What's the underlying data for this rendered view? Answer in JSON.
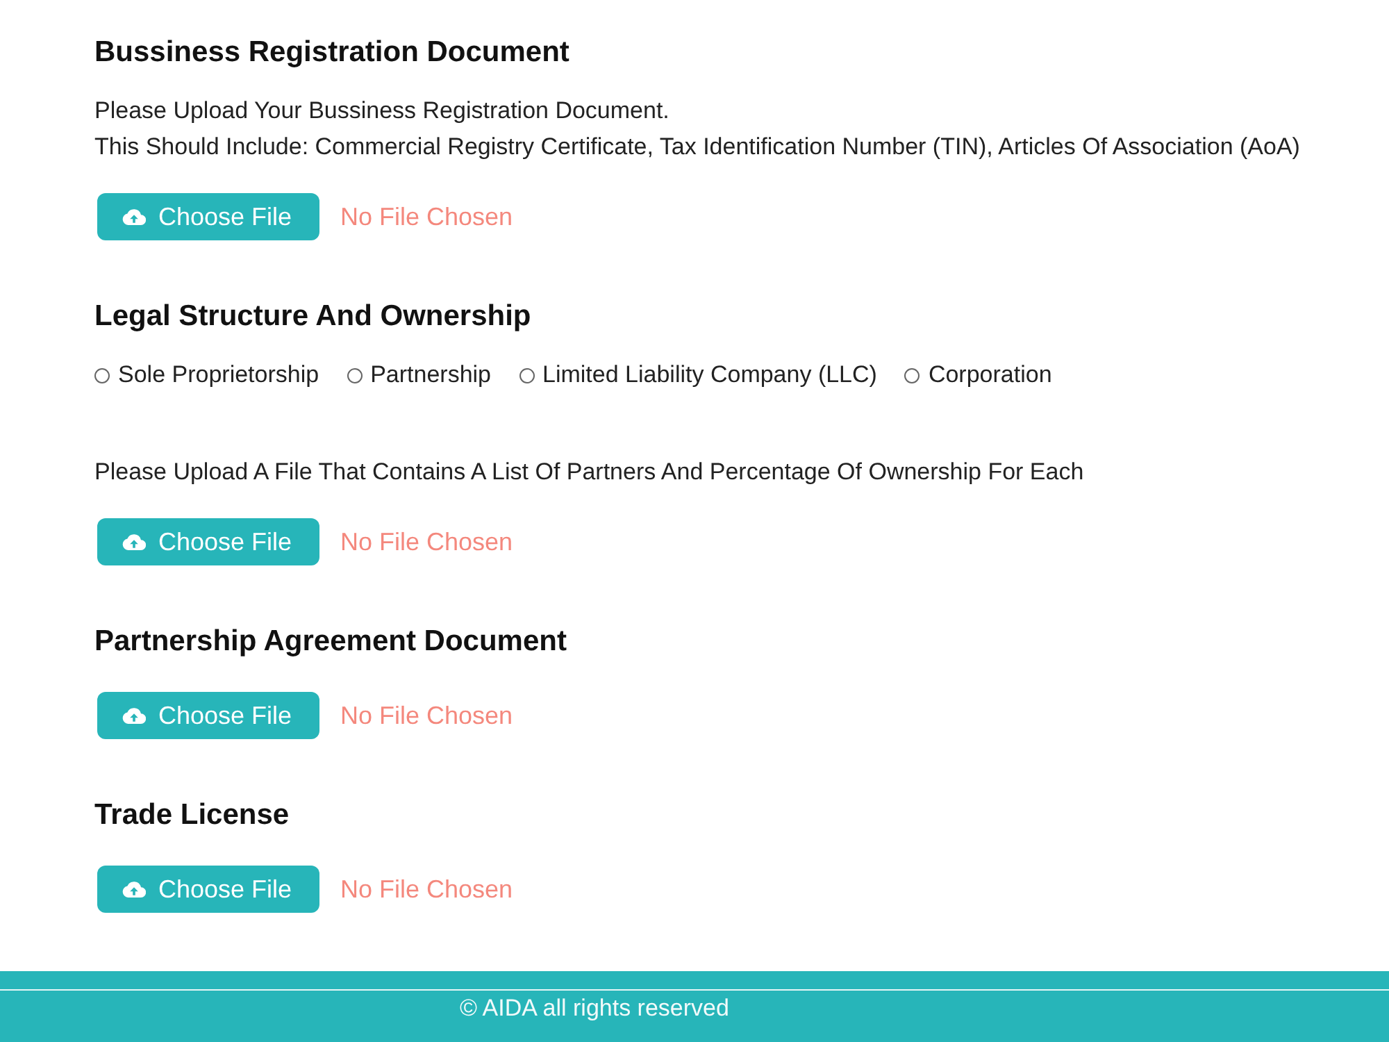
{
  "form": [
    {
      "kind": "heading",
      "text": "Bussiness Registration Document"
    },
    {
      "kind": "text",
      "lines": [
        "Please Upload Your Bussiness Registration Document.",
        "This Should Include: Commercial Registry Certificate, Tax Identification Number (TIN), Articles Of Association (AoA)"
      ]
    },
    {
      "kind": "upload",
      "button": "Choose File",
      "status": "No File Chosen"
    },
    {
      "kind": "heading",
      "text": "Legal Structure And Ownership"
    },
    {
      "kind": "radios",
      "options": [
        {
          "label": "Sole Proprietorship",
          "selected": false
        },
        {
          "label": "Partnership",
          "selected": false
        },
        {
          "label": "Limited Liability Company (LLC)",
          "selected": false
        },
        {
          "label": "Corporation",
          "selected": false
        }
      ]
    },
    {
      "kind": "text",
      "lines": [
        "Please Upload A File That Contains A List Of Partners And Percentage Of Ownership For Each"
      ]
    },
    {
      "kind": "upload",
      "button": "Choose File",
      "status": "No File Chosen"
    },
    {
      "kind": "heading",
      "text": "Partnership Agreement Document"
    },
    {
      "kind": "upload",
      "button": "Choose File",
      "status": "No File Chosen"
    },
    {
      "kind": "heading",
      "text": "Trade License"
    },
    {
      "kind": "upload",
      "button": "Choose File",
      "status": "No File Chosen"
    }
  ],
  "footer": {
    "text": "© AIDA all rights reserved"
  }
}
